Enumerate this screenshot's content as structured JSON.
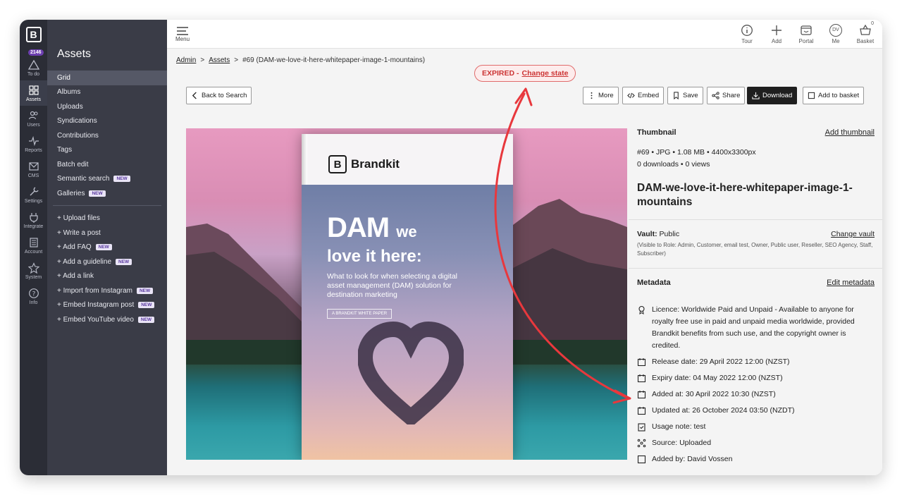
{
  "rail": {
    "badge": "2146",
    "items": [
      {
        "label": "To do"
      },
      {
        "label": "Assets"
      },
      {
        "label": "Users"
      },
      {
        "label": "Reports"
      },
      {
        "label": "CMS"
      },
      {
        "label": "Settings"
      },
      {
        "label": "Integrate"
      },
      {
        "label": "Account"
      },
      {
        "label": "System"
      },
      {
        "label": "Info"
      }
    ]
  },
  "subnav": {
    "title": "Assets",
    "items": [
      "Grid",
      "Albums",
      "Uploads",
      "Syndications",
      "Contributions",
      "Tags",
      "Batch edit",
      "Semantic search",
      "Galleries"
    ],
    "actions": [
      "+ Upload files",
      "+ Write a post",
      "+ Add FAQ",
      "+ Add a guideline",
      "+ Add a link",
      "+ Import from Instagram",
      "+ Embed Instagram post",
      "+ Embed YouTube video"
    ],
    "new_label": "NEW"
  },
  "topbar": {
    "menu_label": "Menu",
    "actions": [
      "Tour",
      "Add",
      "Portal",
      "Me",
      "Basket"
    ],
    "me_initials": "DV",
    "basket_count": "0"
  },
  "breadcrumb": {
    "admin": "Admin",
    "assets": "Assets",
    "current": "#69 (DAM-we-love-it-here-whitepaper-image-1-mountains)"
  },
  "status": {
    "state": "EXPIRED -",
    "link": "Change state"
  },
  "toolbar": {
    "back": "Back to Search",
    "more": "More",
    "embed": "Embed",
    "save": "Save",
    "share": "Share",
    "download": "Download",
    "add_basket": "Add to basket"
  },
  "book": {
    "brand": "Brandkit",
    "h1": "DAM",
    "h1b": "we",
    "h2": "love it here:",
    "sub": "What to look for when selecting a digital asset management (DAM) solution for destination marketing",
    "tag": "A BRANDKIT WHITE PAPER"
  },
  "panel": {
    "thumbnail_label": "Thumbnail",
    "add_thumbnail": "Add thumbnail",
    "file_info": "#69 • JPG • 1.08 MB • 4400x3300px",
    "stats": "0 downloads • 0 views",
    "asset_title": "DAM-we-love-it-here-whitepaper-image-1-mountains",
    "vault_label": "Vault:",
    "vault_value": "Public",
    "change_vault": "Change vault",
    "vault_note": "(Visible to Role: Admin, Customer, email test, Owner, Public user, Reseller, SEO Agency, Staff, Subscriber)",
    "metadata_label": "Metadata",
    "edit_metadata": "Edit metadata",
    "licence": "Licence: Worldwide Paid and Unpaid - Available to anyone for royalty free use in paid and unpaid media worldwide, provided Brandkit benefits from such use, and the copyright owner is credited.",
    "release": "Release date: 29 April 2022 12:00 (NZST)",
    "expiry": "Expiry date: 04 May 2022 12:00 (NZST)",
    "added": "Added at: 30 April 2022 10:30 (NZST)",
    "updated": "Updated at: 26 October 2024 03:50 (NZDT)",
    "usage": "Usage note:  test",
    "source": "Source: Uploaded",
    "added_by": "Added by: David Vossen"
  },
  "colors": {
    "rail": "#2b2d36",
    "subnav": "#3a3c47",
    "expired": "#c33333",
    "arrow": "#e8383d",
    "badge": "#6d3fb0"
  }
}
